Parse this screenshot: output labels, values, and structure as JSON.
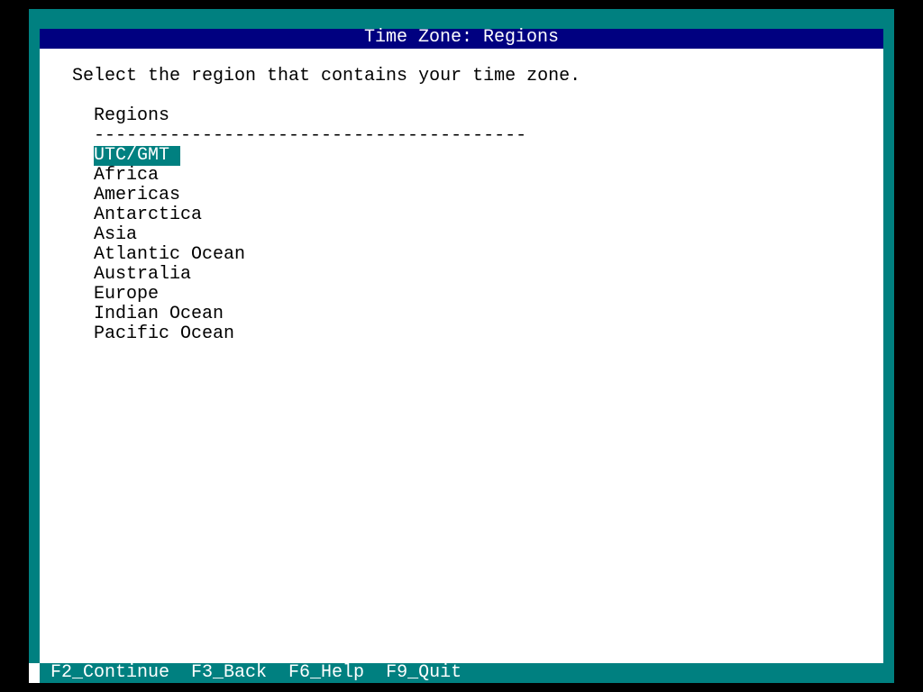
{
  "title": "Time Zone: Regions",
  "instruction": "Select the region that contains your time zone.",
  "list": {
    "header": "Regions",
    "divider": "----------------------------------------",
    "selected_index": 0,
    "items": [
      {
        "label": "UTC/GMT"
      },
      {
        "label": "Africa"
      },
      {
        "label": "Americas"
      },
      {
        "label": "Antarctica"
      },
      {
        "label": "Asia"
      },
      {
        "label": "Atlantic Ocean"
      },
      {
        "label": "Australia"
      },
      {
        "label": "Europe"
      },
      {
        "label": "Indian Ocean"
      },
      {
        "label": "Pacific Ocean"
      }
    ]
  },
  "footer": {
    "keys": [
      {
        "label": "F2_Continue"
      },
      {
        "label": "F3_Back"
      },
      {
        "label": "F6_Help"
      },
      {
        "label": "F9_Quit"
      }
    ]
  },
  "colors": {
    "frame": "#008080",
    "title_bar": "#000080",
    "panel": "#ffffff",
    "selection": "#008080",
    "background": "#000000"
  }
}
